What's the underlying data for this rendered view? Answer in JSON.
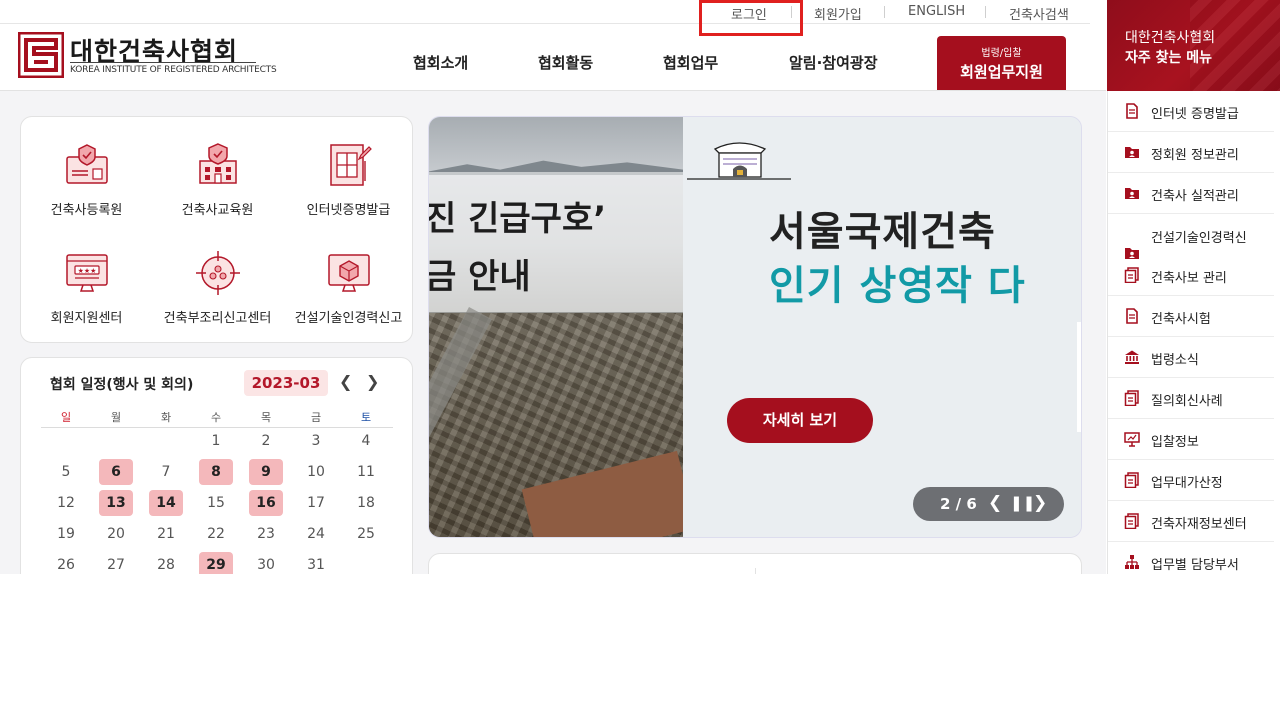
{
  "utility": {
    "login": "로그인",
    "join": "회원가입",
    "english": "ENGLISH",
    "architect_search": "건축사검색"
  },
  "logo": {
    "name_ko": "대한건축사협회",
    "name_en": "KOREA INSTITUTE OF REGISTERED ARCHITECTS"
  },
  "nav": {
    "items": [
      "협회소개",
      "협회활동",
      "협회업무",
      "알림·참여광장"
    ],
    "member_small": "법령/입찰",
    "member_large": "회원업무지원"
  },
  "quick_menu": [
    {
      "label": "건축사등록원",
      "icon": "registration-icon"
    },
    {
      "label": "건축사교육원",
      "icon": "education-building-icon"
    },
    {
      "label": "인터넷증명발급",
      "icon": "certificate-icon"
    },
    {
      "label": "회원지원센터",
      "icon": "support-monitor-icon"
    },
    {
      "label": "건축부조리신고센터",
      "icon": "report-target-icon"
    },
    {
      "label": "건설기술인경력신고",
      "icon": "career-monitor-icon"
    }
  ],
  "calendar": {
    "title": "협회 일정(행사 및 회의)",
    "month": "2023-03",
    "weekdays": [
      "일",
      "월",
      "화",
      "수",
      "목",
      "금",
      "토"
    ],
    "weeks": [
      [
        "",
        "",
        "",
        "1",
        "2",
        "3",
        "4"
      ],
      [
        "5",
        "6",
        "7",
        "8",
        "9",
        "10",
        "11"
      ],
      [
        "12",
        "13",
        "14",
        "15",
        "16",
        "17",
        "18"
      ],
      [
        "19",
        "20",
        "21",
        "22",
        "23",
        "24",
        "25"
      ],
      [
        "26",
        "27",
        "28",
        "29",
        "30",
        "31",
        ""
      ]
    ],
    "event_days": [
      "6",
      "8",
      "9",
      "13",
      "14",
      "16",
      "29"
    ]
  },
  "banner": {
    "left_line1": "진 긴급구호’",
    "left_line2": "금 안내",
    "right_title1": "서울국제건축",
    "right_title2": "인기 상영작 다",
    "more_button": "자세히 보기",
    "page_indicator": "2 / 6",
    "accent_color": "#129aa6"
  },
  "right_panel": {
    "title_line1": "대한건축사협회",
    "title_line2": "자주 찾는 메뉴",
    "items": [
      {
        "label": "인터넷 증명발급",
        "icon": "document-icon"
      },
      {
        "label": "정회원 정보관리",
        "icon": "folder-user-icon"
      },
      {
        "label": "건축사 실적관리",
        "icon": "folder-user-icon"
      },
      {
        "label": "건설기술인경력신",
        "icon": "folder-user-icon"
      },
      {
        "label": "건축사보 관리",
        "icon": "documents-icon"
      },
      {
        "label": "건축사시험",
        "icon": "document-icon"
      },
      {
        "label": "법령소식",
        "icon": "bank-icon"
      },
      {
        "label": "질의회신사례",
        "icon": "documents-icon"
      },
      {
        "label": "입찰정보",
        "icon": "presentation-icon"
      },
      {
        "label": "업무대가산정",
        "icon": "documents-icon"
      },
      {
        "label": "건축자재정보센터",
        "icon": "documents-icon"
      },
      {
        "label": "업무별 담당부서",
        "icon": "org-chart-icon"
      }
    ]
  },
  "colors": {
    "brand": "#a50f1e",
    "event_highlight": "#f4b8bb",
    "login_outline": "#e0201f"
  }
}
